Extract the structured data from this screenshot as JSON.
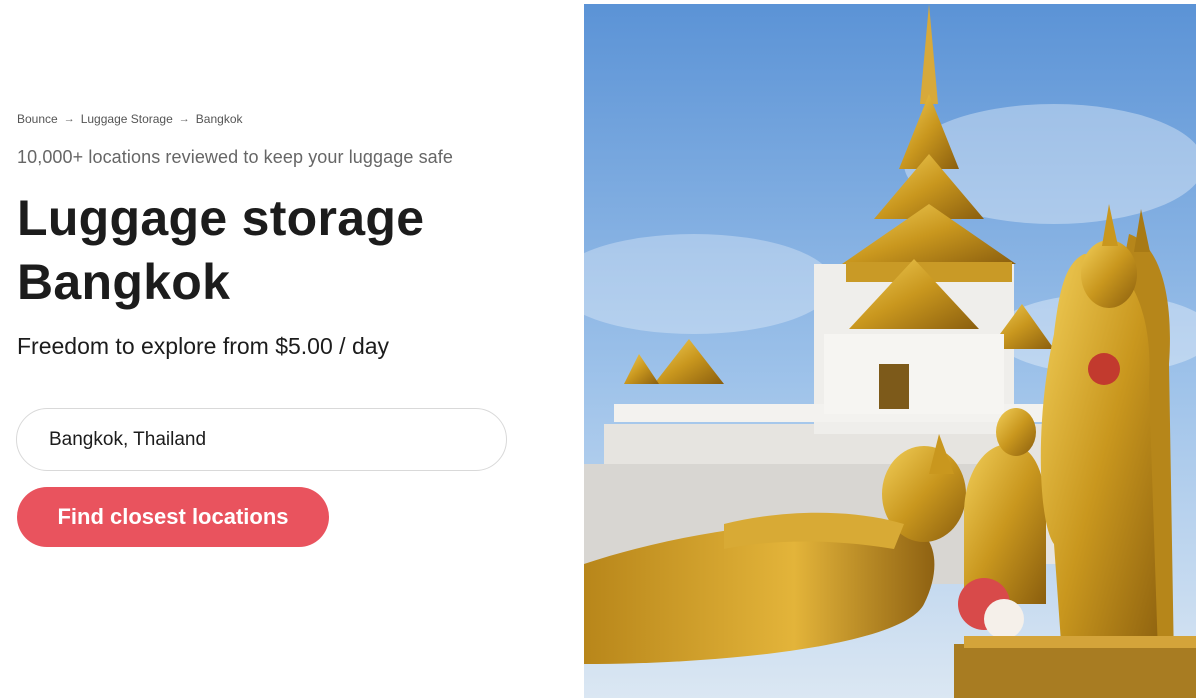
{
  "breadcrumb": {
    "items": [
      "Bounce",
      "Luggage Storage",
      "Bangkok"
    ],
    "separator": "→"
  },
  "tagline": "10,000+ locations reviewed to keep your luggage safe",
  "title": {
    "line1": "Luggage storage",
    "line2": "Bangkok"
  },
  "price_text": "Freedom to explore from $5.00 / day",
  "search": {
    "value": "Bangkok, Thailand"
  },
  "cta_label": "Find closest locations",
  "hero_image": {
    "subject": "golden-temple-with-buddha-statues"
  },
  "colors": {
    "accent": "#e9535e",
    "text": "#1c1c1c",
    "muted": "#666666"
  }
}
